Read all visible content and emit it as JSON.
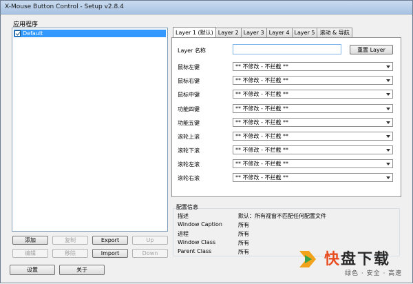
{
  "window": {
    "title": "X-Mouse Button Control - Setup v2.8.4"
  },
  "app_section": {
    "label": "应用程序",
    "items": [
      {
        "label": "Default",
        "checked": true,
        "selected": true
      }
    ]
  },
  "left_buttons": {
    "add": "添加",
    "copy": "复制",
    "export": "Export",
    "up": "Up",
    "edit": "编辑",
    "remove": "移除",
    "import": "Import",
    "down": "Down"
  },
  "bottom_buttons": {
    "settings": "设置",
    "about": "关于"
  },
  "tabs": [
    {
      "label": "Layer 1 (默认)",
      "active": true
    },
    {
      "label": "Layer 2",
      "active": false
    },
    {
      "label": "Layer 3",
      "active": false
    },
    {
      "label": "Layer 4",
      "active": false
    },
    {
      "label": "Layer 5",
      "active": false
    },
    {
      "label": "滚动 & 导航",
      "active": false
    }
  ],
  "layer": {
    "name_label": "Layer 名称",
    "name_value": "",
    "reset_button": "重置 Layer",
    "rows": [
      {
        "label": "鼠标左键",
        "value": "** 不修改 - 不拦截 **"
      },
      {
        "label": "鼠标右键",
        "value": "** 不修改 - 不拦截 **"
      },
      {
        "label": "鼠标中键",
        "value": "** 不修改 - 不拦截 **"
      },
      {
        "label": "功能四键",
        "value": "** 不修改 - 不拦截 **"
      },
      {
        "label": "功能五键",
        "value": "** 不修改 - 不拦截 **"
      },
      {
        "label": "滚轮上滚",
        "value": "** 不修改 - 不拦截 **"
      },
      {
        "label": "滚轮下滚",
        "value": "** 不修改 - 不拦截 **"
      },
      {
        "label": "滚轮左滚",
        "value": "** 不修改 - 不拦截 **"
      },
      {
        "label": "滚轮右滚",
        "value": "** 不修改 - 不拦截 **"
      }
    ]
  },
  "config_info": {
    "legend": "配置信息",
    "rows": [
      {
        "key": "描述",
        "value": "默认：所有视窗不匹配任何配置文件"
      },
      {
        "key": "Window Caption",
        "value": "所有"
      },
      {
        "key": "进程",
        "value": "所有"
      },
      {
        "key": "Window Class",
        "value": "所有"
      },
      {
        "key": "Parent Class",
        "value": "所有"
      }
    ]
  },
  "watermark": {
    "brand_first": "快",
    "brand_rest": "盘下载",
    "slogan": "绿色 · 安全 · 高速"
  },
  "colors": {
    "selection": "#3399ff",
    "accent_orange": "#e84c1e"
  }
}
